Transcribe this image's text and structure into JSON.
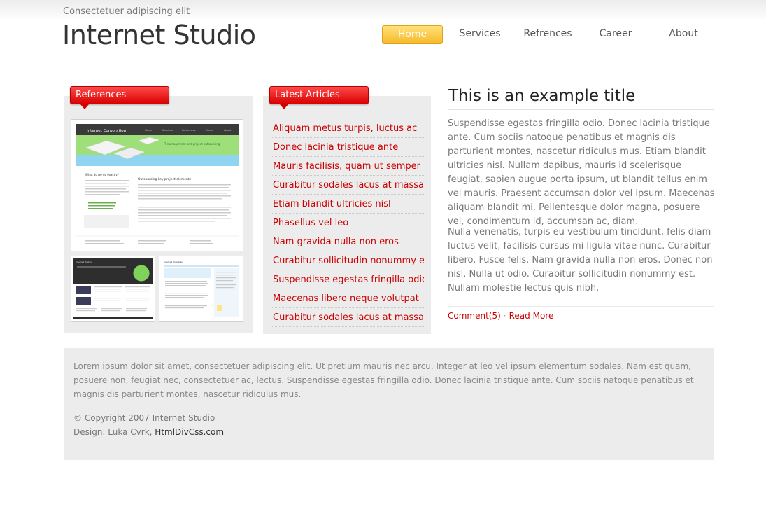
{
  "header": {
    "tagline": "Consectetuer adipiscing elit",
    "site_title": "Internet Studio"
  },
  "nav": [
    {
      "label": "Home",
      "active": true
    },
    {
      "label": "Services"
    },
    {
      "label": "Refrences"
    },
    {
      "label": "Career"
    },
    {
      "label": "About"
    }
  ],
  "references": {
    "heading": "References",
    "thumb_main": {
      "brand": "Internet Corporation",
      "menu": [
        "Home",
        "Services",
        "References",
        "Career",
        "About"
      ],
      "banner": "IT management and project outsourcing",
      "left_heading": "What do we do exactly?",
      "right_heading": "Outsourcing key project elements"
    },
    "thumb_small_1": {
      "brand": "Internet Hosting"
    },
    "thumb_small_2": {
      "brand": "Internet Broadcast"
    }
  },
  "articles": {
    "heading": "Latest Articles",
    "items": [
      "Aliquam metus turpis, luctus ac",
      "Donec lacinia tristique ante",
      "Mauris facilisis, quam ut semper",
      "Curabitur sodales lacus at massa",
      "Etiam blandit ultricies nisl",
      "Phasellus vel leo",
      "Nam gravida nulla non eros",
      "Curabitur sollicitudin nonummy est",
      "Suspendisse egestas fringilla odio",
      "Maecenas libero neque volutpat",
      "Curabitur sodales lacus at massa"
    ]
  },
  "post": {
    "title": "This is an example title",
    "paragraph_1": "Suspendisse egestas fringilla odio. Donec lacinia tristique ante. Cum sociis natoque penatibus et magnis dis parturient montes, nascetur ridiculus mus. Etiam blandit ultricies nisl. Nullam dapibus, mauris id scelerisque feugiat, sapien augue porta ipsum, ut blandit tellus enim vel mauris. Praesent accumsan dolor vel ipsum. Maecenas aliquam blandit mi. Pellentesque dolor magna, posuere vel, condimentum id, accumsan ac, diam.",
    "paragraph_2": "Nulla venenatis, turpis eu vestibulum tincidunt, felis diam luctus velit, facilisis cursus mi ligula vitae nunc. Curabitur libero. Fusce felis. Nam gravida nulla non eros. Donec non nisl. Nulla ut odio. Curabitur sollicitudin nonummy est. Nullam molestie lectus quis nibh.",
    "comments": "Comment(5)",
    "separator": "·",
    "read_more": "Read More"
  },
  "footer": {
    "text": "Lorem ipsum dolor sit amet, consectetuer adipiscing elit. Ut pretium mauris nec arcu. Integer at leo vel ipsum elementum sodales. Nam est quam, posuere non, feugiat nec, consectetuer ac, lectus. Suspendisse egestas fringilla odio. Donec lacinia tristique ante. Cum sociis natoque penatibus et magnis dis parturient montes, nascetur ridiculus mus.",
    "copyright": "© Copyright 2007 Internet Studio",
    "design_prefix": "Design: Luka Cvrk, ",
    "design_link": "HtmlDivCss.com"
  }
}
